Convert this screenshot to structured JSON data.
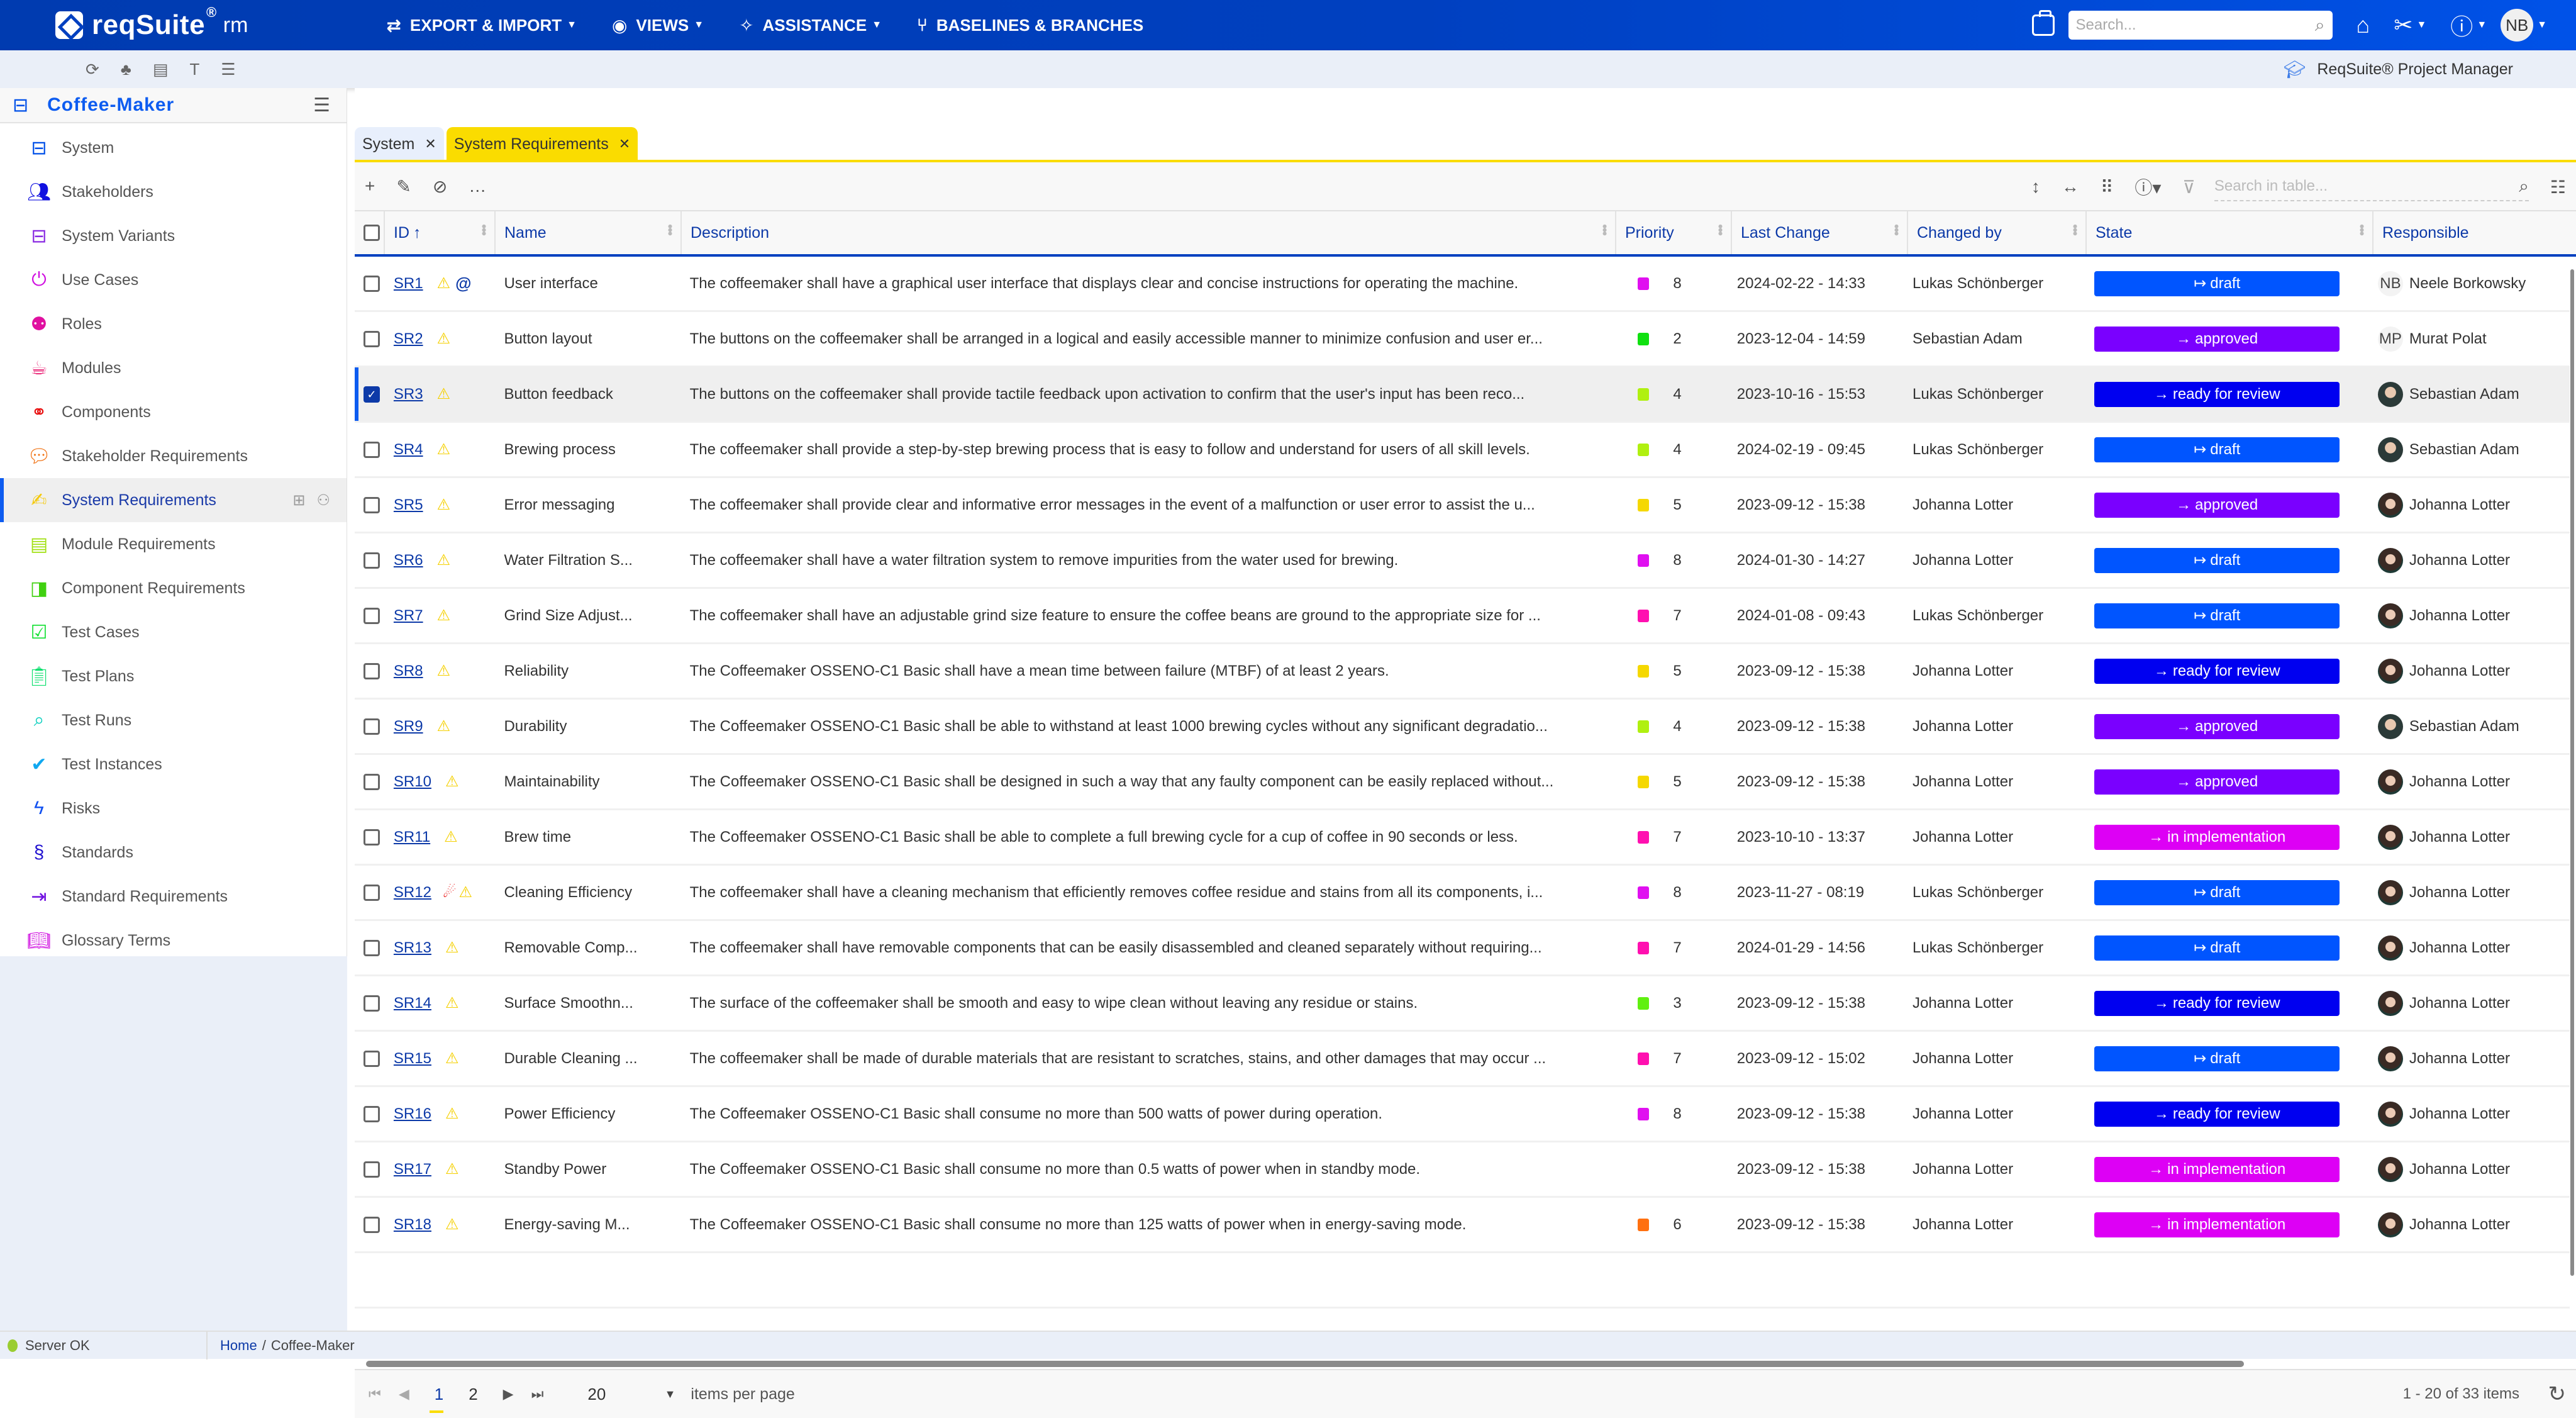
{
  "app": {
    "brand": "reqSuite",
    "brand_reg": "®",
    "brand_suffix": "rm",
    "colors": {
      "primary": "#0040c0",
      "accent_yellow": "#fadc00",
      "link": "#0d3aa8"
    }
  },
  "topnav": {
    "menus": [
      {
        "label": "EXPORT & IMPORT",
        "icon": "swap-arrows-icon",
        "has_dropdown": true
      },
      {
        "label": "VIEWS",
        "icon": "eye-icon",
        "has_dropdown": true
      },
      {
        "label": "ASSISTANCE",
        "icon": "magic-wand-icon",
        "has_dropdown": true
      },
      {
        "label": "BASELINES & BRANCHES",
        "icon": "branch-icon",
        "has_dropdown": false
      }
    ],
    "search_placeholder": "Search...",
    "user_initials": "NB"
  },
  "subbar": {
    "icons": [
      "refresh-icon",
      "hierarchy-icon",
      "calculator-icon",
      "text-icon",
      "database-icon"
    ],
    "role_label": "ReqSuite® Project Manager"
  },
  "sidebar": {
    "project": "Coffee-Maker",
    "items": [
      {
        "label": "System",
        "icon": "coffee-pot-icon",
        "color": "#0050e8"
      },
      {
        "label": "Stakeholders",
        "icon": "people-icon",
        "color": "#1010e0"
      },
      {
        "label": "System Variants",
        "icon": "coffee-pot-variant-icon",
        "color": "#8a2be2"
      },
      {
        "label": "Use Cases",
        "icon": "power-icon",
        "color": "#d010e0"
      },
      {
        "label": "Roles",
        "icon": "person-burst-icon",
        "color": "#e010a0"
      },
      {
        "label": "Modules",
        "icon": "cup-icon",
        "color": "#e8106a"
      },
      {
        "label": "Components",
        "icon": "coffee-beans-icon",
        "color": "#e81010"
      },
      {
        "label": "Stakeholder Requirements",
        "icon": "chat-icon",
        "color": "#f07010"
      },
      {
        "label": "System Requirements",
        "icon": "document-sign-icon",
        "color": "#f5c800",
        "active": true
      },
      {
        "label": "Module Requirements",
        "icon": "document-lines-icon",
        "color": "#a0e010"
      },
      {
        "label": "Component Requirements",
        "icon": "document-shield-icon",
        "color": "#40d010"
      },
      {
        "label": "Test Cases",
        "icon": "checklist-icon",
        "color": "#10e030"
      },
      {
        "label": "Test Plans",
        "icon": "clipboard-icon",
        "color": "#10e070"
      },
      {
        "label": "Test Runs",
        "icon": "document-search-icon",
        "color": "#10d0c0"
      },
      {
        "label": "Test Instances",
        "icon": "document-check-icon",
        "color": "#10a8f0"
      },
      {
        "label": "Risks",
        "icon": "lightning-icon",
        "color": "#1050f0"
      },
      {
        "label": "Standards",
        "icon": "paragraph-book-icon",
        "color": "#2010d0"
      },
      {
        "label": "Standard Requirements",
        "icon": "document-import-icon",
        "color": "#7010e0"
      },
      {
        "label": "Glossary Terms",
        "icon": "open-book-icon",
        "color": "#d010e0"
      }
    ]
  },
  "tabs": [
    {
      "label": "System",
      "active": false
    },
    {
      "label": "System Requirements",
      "active": true
    }
  ],
  "toolbar": {
    "search_placeholder": "Search in table..."
  },
  "table": {
    "columns": [
      "ID",
      "Name",
      "Description",
      "Priority",
      "Last Change",
      "Changed by",
      "State",
      "Responsible"
    ],
    "sort": {
      "column": "ID",
      "direction": "ascending"
    },
    "state_colors": {
      "draft": "#0055ff",
      "approved": "#7a00ff",
      "ready for review": "#0000f0",
      "in implementation": "#dd00f5"
    },
    "rows": [
      {
        "id": "SR1",
        "flags": [
          "warning",
          "mention"
        ],
        "name": "User interface",
        "description": "The coffeemaker shall have a graphical user interface that displays clear and concise instructions for operating the machine.",
        "priority": "8",
        "priority_color": "#e010f0",
        "last_change": "2024-02-22 - 14:33",
        "changed_by": "Lukas Schönberger",
        "state": "draft",
        "state_prefix": "↦",
        "responsible": "Neele Borkowsky",
        "responsible_initials": "NB",
        "selected": false
      },
      {
        "id": "SR2",
        "flags": [
          "warning"
        ],
        "name": "Button layout",
        "description": "The buttons on the coffeemaker shall be arranged in a logical and easily accessible manner to minimize confusion and user er...",
        "priority": "2",
        "priority_color": "#10e010",
        "last_change": "2023-12-04 - 14:59",
        "changed_by": "Sebastian Adam",
        "state": "approved",
        "state_prefix": "→",
        "responsible": "Murat Polat",
        "responsible_initials": "MP",
        "selected": false
      },
      {
        "id": "SR3",
        "flags": [
          "warning"
        ],
        "name": "Button feedback",
        "description": "The buttons on the coffeemaker shall provide tactile feedback upon activation to confirm that the user's input has been reco...",
        "priority": "4",
        "priority_color": "#b0f010",
        "last_change": "2023-10-16 - 15:53",
        "changed_by": "Lukas Schönberger",
        "state": "ready for review",
        "state_prefix": "→",
        "responsible": "Sebastian Adam",
        "responsible_initials": "",
        "selected": true
      },
      {
        "id": "SR4",
        "flags": [
          "warning"
        ],
        "name": "Brewing process",
        "description": "The coffeemaker shall provide a step-by-step brewing process that is easy to follow and understand for users of all skill levels.",
        "priority": "4",
        "priority_color": "#b0f010",
        "last_change": "2024-02-19 - 09:45",
        "changed_by": "Lukas Schönberger",
        "state": "draft",
        "state_prefix": "↦",
        "responsible": "Sebastian Adam",
        "responsible_initials": "",
        "selected": false
      },
      {
        "id": "SR5",
        "flags": [
          "warning"
        ],
        "name": "Error messaging",
        "description": "The coffeemaker shall provide clear and informative error messages in the event of a malfunction or user error to assist the u...",
        "priority": "5",
        "priority_color": "#f5d800",
        "last_change": "2023-09-12 - 15:38",
        "changed_by": "Johanna Lotter",
        "state": "approved",
        "state_prefix": "→",
        "responsible": "Johanna Lotter",
        "responsible_initials": "",
        "selected": false
      },
      {
        "id": "SR6",
        "flags": [
          "warning"
        ],
        "name": "Water Filtration S...",
        "description": "The coffeemaker shall have a water filtration system to remove impurities from the water used for brewing.",
        "priority": "8",
        "priority_color": "#e010f0",
        "last_change": "2024-01-30 - 14:27",
        "changed_by": "Johanna Lotter",
        "state": "draft",
        "state_prefix": "↦",
        "responsible": "Johanna Lotter",
        "responsible_initials": "",
        "selected": false
      },
      {
        "id": "SR7",
        "flags": [
          "warning"
        ],
        "name": "Grind Size Adjust...",
        "description": "The coffeemaker shall have an adjustable grind size feature to ensure the coffee beans are ground to the appropriate size for ...",
        "priority": "7",
        "priority_color": "#ff10b0",
        "last_change": "2024-01-08 - 09:43",
        "changed_by": "Lukas Schönberger",
        "state": "draft",
        "state_prefix": "↦",
        "responsible": "Johanna Lotter",
        "responsible_initials": "",
        "selected": false
      },
      {
        "id": "SR8",
        "flags": [
          "warning"
        ],
        "name": "Reliability",
        "description": "The Coffeemaker OSSENO-C1 Basic shall have a mean time between failure (MTBF) of at least 2 years.",
        "priority": "5",
        "priority_color": "#f5d800",
        "last_change": "2023-09-12 - 15:38",
        "changed_by": "Johanna Lotter",
        "state": "ready for review",
        "state_prefix": "→",
        "responsible": "Johanna Lotter",
        "responsible_initials": "",
        "selected": false
      },
      {
        "id": "SR9",
        "flags": [
          "warning"
        ],
        "name": "Durability",
        "description": "The Coffeemaker OSSENO-C1 Basic shall be able to withstand at least 1000 brewing cycles without any significant degradatio...",
        "priority": "4",
        "priority_color": "#b0f010",
        "last_change": "2023-09-12 - 15:38",
        "changed_by": "Johanna Lotter",
        "state": "approved",
        "state_prefix": "→",
        "responsible": "Sebastian Adam",
        "responsible_initials": "",
        "selected": false
      },
      {
        "id": "SR10",
        "flags": [
          "warning"
        ],
        "name": "Maintainability",
        "description": "The Coffeemaker OSSENO-C1 Basic shall be designed in such a way that any faulty component can be easily replaced without...",
        "priority": "5",
        "priority_color": "#f5d800",
        "last_change": "2023-09-12 - 15:38",
        "changed_by": "Johanna Lotter",
        "state": "approved",
        "state_prefix": "→",
        "responsible": "Johanna Lotter",
        "responsible_initials": "",
        "selected": false
      },
      {
        "id": "SR11",
        "flags": [
          "warning"
        ],
        "name": "Brew time",
        "description": "The Coffeemaker OSSENO-C1 Basic shall be able to complete a full brewing cycle for a cup of coffee in 90 seconds or less.",
        "priority": "7",
        "priority_color": "#ff10b0",
        "last_change": "2023-10-10 - 13:37",
        "changed_by": "Johanna Lotter",
        "state": "in implementation",
        "state_prefix": "→",
        "responsible": "Johanna Lotter",
        "responsible_initials": "",
        "selected": false
      },
      {
        "id": "SR12",
        "flags": [
          "risk",
          "warning"
        ],
        "name": "Cleaning Efficiency",
        "description": "The coffeemaker shall have a cleaning mechanism that efficiently removes coffee residue and stains from all its components, i...",
        "priority": "8",
        "priority_color": "#e010f0",
        "last_change": "2023-11-27 - 08:19",
        "changed_by": "Lukas Schönberger",
        "state": "draft",
        "state_prefix": "↦",
        "responsible": "Johanna Lotter",
        "responsible_initials": "",
        "selected": false
      },
      {
        "id": "SR13",
        "flags": [
          "warning"
        ],
        "name": "Removable Comp...",
        "description": "The coffeemaker shall have removable components that can be easily disassembled and cleaned separately without requiring...",
        "priority": "7",
        "priority_color": "#ff10b0",
        "last_change": "2024-01-29 - 14:56",
        "changed_by": "Lukas Schönberger",
        "state": "draft",
        "state_prefix": "↦",
        "responsible": "Johanna Lotter",
        "responsible_initials": "",
        "selected": false
      },
      {
        "id": "SR14",
        "flags": [
          "warning"
        ],
        "name": "Surface Smoothn...",
        "description": "The surface of the coffeemaker shall be smooth and easy to wipe clean without leaving any residue or stains.",
        "priority": "3",
        "priority_color": "#60f010",
        "last_change": "2023-09-12 - 15:38",
        "changed_by": "Johanna Lotter",
        "state": "ready for review",
        "state_prefix": "→",
        "responsible": "Johanna Lotter",
        "responsible_initials": "",
        "selected": false
      },
      {
        "id": "SR15",
        "flags": [
          "warning"
        ],
        "name": "Durable Cleaning ...",
        "description": "The coffeemaker shall be made of durable materials that are resistant to scratches, stains, and other damages that may occur ...",
        "priority": "7",
        "priority_color": "#ff10b0",
        "last_change": "2023-09-12 - 15:02",
        "changed_by": "Johanna Lotter",
        "state": "draft",
        "state_prefix": "↦",
        "responsible": "Johanna Lotter",
        "responsible_initials": "",
        "selected": false
      },
      {
        "id": "SR16",
        "flags": [
          "warning"
        ],
        "name": "Power Efficiency",
        "description": "The Coffeemaker OSSENO-C1 Basic shall consume no more than 500 watts of power during operation.",
        "priority": "8",
        "priority_color": "#e010f0",
        "last_change": "2023-09-12 - 15:38",
        "changed_by": "Johanna Lotter",
        "state": "ready for review",
        "state_prefix": "→",
        "responsible": "Johanna Lotter",
        "responsible_initials": "",
        "selected": false
      },
      {
        "id": "SR17",
        "flags": [
          "warning"
        ],
        "name": "Standby Power",
        "description": "The Coffeemaker OSSENO-C1 Basic shall consume no more than 0.5 watts of power when in standby mode.",
        "priority": "",
        "priority_color": "",
        "last_change": "2023-09-12 - 15:38",
        "changed_by": "Johanna Lotter",
        "state": "in implementation",
        "state_prefix": "→",
        "responsible": "Johanna Lotter",
        "responsible_initials": "",
        "selected": false
      },
      {
        "id": "SR18",
        "flags": [
          "warning"
        ],
        "name": "Energy-saving M...",
        "description": "The Coffeemaker OSSENO-C1 Basic shall consume no more than 125 watts of power when in energy-saving mode.",
        "priority": "6",
        "priority_color": "#ff7010",
        "last_change": "2023-09-12 - 15:38",
        "changed_by": "Johanna Lotter",
        "state": "in implementation",
        "state_prefix": "→",
        "responsible": "Johanna Lotter",
        "responsible_initials": "",
        "selected": false
      }
    ]
  },
  "pagination": {
    "pages": [
      "1",
      "2"
    ],
    "current_page": "1",
    "page_size": "20",
    "page_size_label": "items per page",
    "summary": "1 - 20 of 33 items"
  },
  "statusbar": {
    "server_status": "Server OK",
    "server_color": "#9acd32",
    "breadcrumb": [
      "Home",
      "Coffee-Maker"
    ]
  }
}
